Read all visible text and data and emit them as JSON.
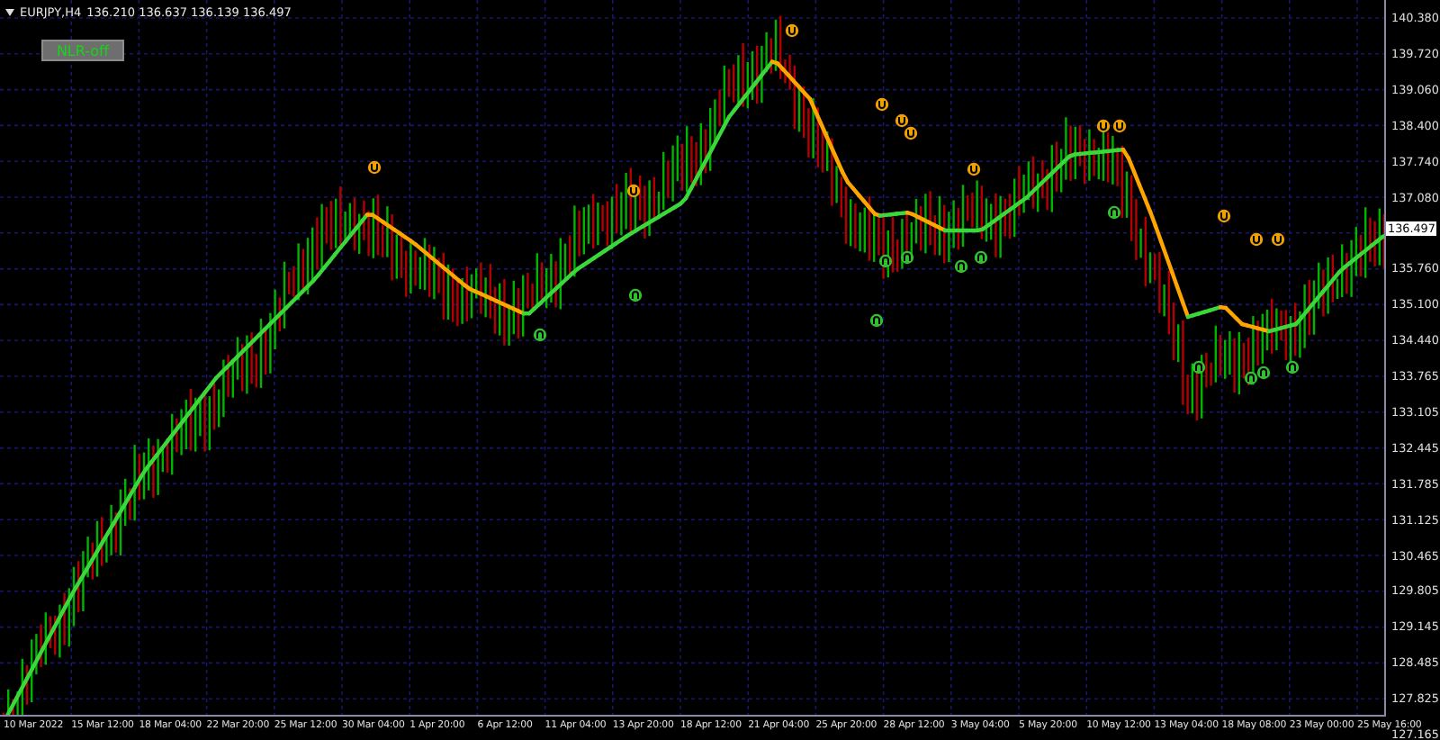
{
  "chart_header": {
    "symbol": "EURJPY,H4",
    "quotes": "136.210 136.637 136.139 136.497"
  },
  "indicator_button": {
    "label": "NLR-off"
  },
  "price_axis": {
    "labels": [
      "140.380",
      "139.720",
      "139.060",
      "138.400",
      "137.740",
      "137.080",
      "135.760",
      "135.100",
      "134.440",
      "133.765",
      "133.105",
      "132.445",
      "131.785",
      "131.125",
      "130.465",
      "129.805",
      "129.145",
      "128.485",
      "127.825",
      "127.165"
    ],
    "current_price": "136.497"
  },
  "time_axis": {
    "labels": [
      "10 Mar 2022",
      "15 Mar 12:00",
      "18 Mar 04:00",
      "22 Mar 20:00",
      "25 Mar 12:00",
      "30 Mar 04:00",
      "1 Apr 20:00",
      "6 Apr 12:00",
      "11 Apr 04:00",
      "13 Apr 20:00",
      "18 Apr 12:00",
      "21 Apr 04:00",
      "25 Apr 20:00",
      "28 Apr 12:00",
      "3 May 04:00",
      "5 May 20:00",
      "10 May 12:00",
      "13 May 04:00",
      "18 May 08:00",
      "23 May 00:00",
      "25 May 16:00"
    ]
  }
}
